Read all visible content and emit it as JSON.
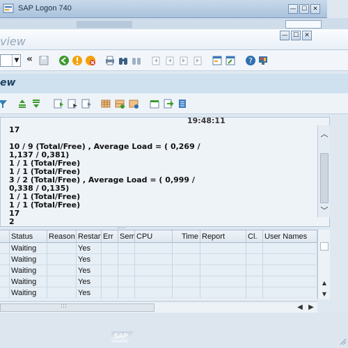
{
  "logon_window": {
    "title": "SAP Logon 740",
    "min": "—",
    "max": "☐",
    "close": "✕"
  },
  "window": {
    "title_partial": "view",
    "min": "—",
    "max": "☐",
    "close": "✕"
  },
  "screen": {
    "title_partial": "ew"
  },
  "text_panel": {
    "timestamp_partial": "19:48:11",
    "lines": [
      "17",
      "10 / 9 (Total/Free) , Average Load = ( 0,269 /",
      "1,137 / 0,381)",
      "1 / 1 (Total/Free)",
      "1 / 1 (Total/Free)",
      "3 / 2 (Total/Free) , Average Load = ( 0,999 /",
      "0,338 / 0,135)",
      "1 / 1 (Total/Free)",
      "1 / 1 (Total/Free)",
      "17",
      "2"
    ],
    "splitter": "....."
  },
  "table": {
    "columns": [
      "Status",
      "Reason",
      "Restart",
      "Err",
      "Sem",
      "CPU",
      "Time",
      "Report",
      "Cl.",
      "User Names"
    ],
    "rows": [
      {
        "status": "Waiting",
        "restart": "Yes"
      },
      {
        "status": "Waiting",
        "restart": "Yes"
      },
      {
        "status": "Waiting",
        "restart": "Yes"
      },
      {
        "status": "Waiting",
        "restart": "Yes"
      },
      {
        "status": "Waiting",
        "restart": "Yes"
      }
    ],
    "hscroll_grip": ":::",
    "arrows": {
      "up": "▲",
      "down": "▼",
      "left": "◀",
      "right": "▶"
    }
  },
  "toolbar": {
    "cmd_arrow": "▼",
    "raquo": "«"
  },
  "sap_logo": "SAP",
  "colors": {
    "title": "#1e3f63",
    "accent_green": "#3c9a2c",
    "accent_red": "#d2432b",
    "accent_orange": "#f2a20c"
  }
}
